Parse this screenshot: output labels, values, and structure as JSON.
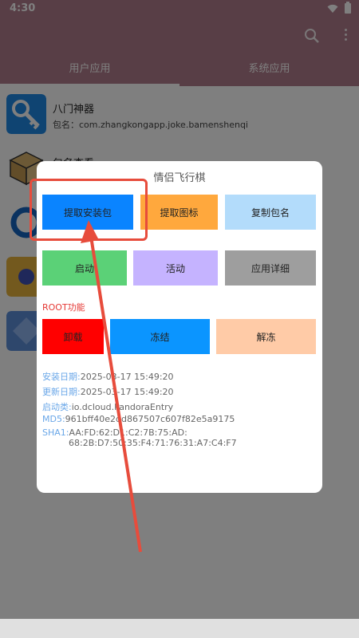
{
  "status": {
    "time": "4:30"
  },
  "tabs": [
    {
      "label": "用户应用"
    },
    {
      "label": "系统应用"
    }
  ],
  "apps": [
    {
      "name": "八门神器",
      "pkg": "包名：com.zhangkongapp.joke.bamenshenqi"
    },
    {
      "name": "包名查看",
      "pkg": ""
    }
  ],
  "dialog": {
    "title": "情侣飞行棋",
    "buttons": {
      "extract_apk": "提取安装包",
      "extract_icon": "提取图标",
      "copy_pkg": "复制包名",
      "launch": "启动",
      "activity": "活动",
      "app_detail": "应用详细",
      "uninstall": "卸载",
      "freeze": "冻结",
      "unfreeze": "解冻"
    },
    "root_label": "ROOT功能",
    "info": {
      "install_key": "安装日期:",
      "install_val": "2025-03-17 15:49:20",
      "update_key": "更新日期:",
      "update_val": "2025-03-17 15:49:20",
      "launcher_key": "启动类:",
      "launcher_val": "io.dcloud.PandoraEntry",
      "md5_key": "MD5:",
      "md5_val": "961bff40e2dd867507c607f82e5a9175",
      "sha1_key": "SHA1:",
      "sha1_val1": "AA:FD:62:D1:C2:7B:75:AD:",
      "sha1_val2": "68:2B:D7:50:35:F4:71:76:31:A7:C4:F7"
    }
  },
  "colors": {
    "primary": "#b07d8c",
    "btn_blue": "#0a84ff",
    "btn_orange": "#ffa83d",
    "btn_lightblue": "#b3dcfb",
    "btn_green": "#5bd177",
    "btn_lavender": "#c5b3ff",
    "btn_gray": "#9e9e9e",
    "btn_red": "#ff0000",
    "btn_skyblue": "#0b95ff",
    "btn_peach": "#ffcba7",
    "annotation": "#e74c3c"
  }
}
